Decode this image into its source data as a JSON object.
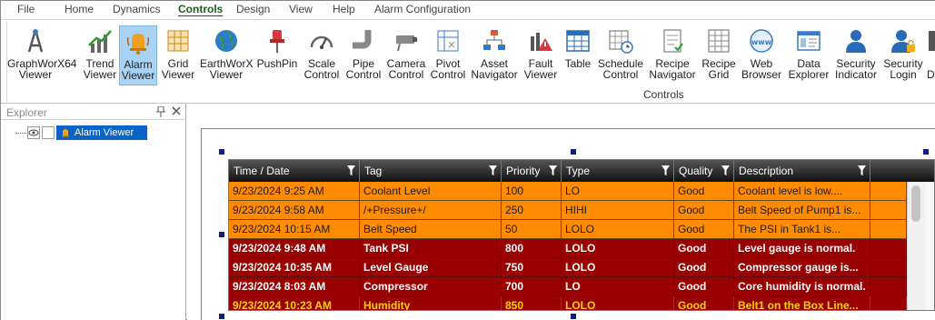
{
  "menu": {
    "items": [
      "File",
      "Home",
      "Dynamics",
      "Controls",
      "Design",
      "View",
      "Help",
      "Alarm Configuration"
    ],
    "active": "Controls"
  },
  "ribbon": {
    "group_label": "Controls",
    "buttons": [
      {
        "line1": "GraphWorX64",
        "line2": "Viewer",
        "icon": "graphworx-icon"
      },
      {
        "line1": "Trend",
        "line2": "Viewer",
        "icon": "trend-icon"
      },
      {
        "line1": "Alarm",
        "line2": "Viewer",
        "icon": "alarm-bell-icon"
      },
      {
        "line1": "Grid",
        "line2": "Viewer",
        "icon": "grid-icon"
      },
      {
        "line1": "EarthWorX",
        "line2": "Viewer",
        "icon": "globe-icon"
      },
      {
        "line1": "PushPin",
        "line2": "",
        "icon": "pushpin-icon"
      },
      {
        "line1": "Scale",
        "line2": "Control",
        "icon": "gauge-icon"
      },
      {
        "line1": "Pipe",
        "line2": "Control",
        "icon": "pipe-icon"
      },
      {
        "line1": "Camera",
        "line2": "Control",
        "icon": "camera-icon"
      },
      {
        "line1": "Pivot",
        "line2": "Control",
        "icon": "pivot-icon"
      },
      {
        "line1": "Asset",
        "line2": "Navigator",
        "icon": "asset-tree-icon"
      },
      {
        "line1": "Fault",
        "line2": "Viewer",
        "icon": "fault-icon"
      },
      {
        "line1": "Table",
        "line2": "",
        "icon": "table-icon"
      },
      {
        "line1": "Schedule",
        "line2": "Control",
        "icon": "schedule-icon"
      },
      {
        "line1": "Recipe",
        "line2": "Navigator",
        "icon": "recipe-nav-icon"
      },
      {
        "line1": "Recipe",
        "line2": "Grid",
        "icon": "recipe-grid-icon"
      },
      {
        "line1": "Web",
        "line2": "Browser",
        "icon": "www-icon"
      },
      {
        "line1": "Data",
        "line2": "Explorer",
        "icon": "data-explorer-icon"
      },
      {
        "line1": "Security",
        "line2": "Indicator",
        "icon": "security-user-icon"
      },
      {
        "line1": "Security",
        "line2": "Login",
        "icon": "security-login-icon"
      },
      {
        "line1": "",
        "line2": "Di",
        "icon": "partial-icon"
      }
    ]
  },
  "explorer": {
    "title": "Explorer",
    "tree_item": "Alarm Viewer"
  },
  "alarm_grid": {
    "columns": [
      "Time / Date",
      "Tag",
      "Priority",
      "Type",
      "Quality",
      "Description"
    ],
    "rows": [
      {
        "time": "9/23/2024 9:25 AM",
        "tag": "Coolant Level",
        "priority": "100",
        "type": "LO",
        "quality": "Good",
        "desc": "Coolant level is low....",
        "style": "orange"
      },
      {
        "time": "9/23/2024 9:58 AM",
        "tag": "/+Pressure+/",
        "priority": "250",
        "type": "HIHI",
        "quality": "Good",
        "desc": "Belt Speed of Pump1 is...",
        "style": "orange"
      },
      {
        "time": "9/23/2024 10:15 AM",
        "tag": "Belt Speed",
        "priority": "50",
        "type": "LOLO",
        "quality": "Good",
        "desc": "The PSI in Tank1 is...",
        "style": "orange"
      },
      {
        "time": "9/23/2024 9:48 AM",
        "tag": "Tank PSI",
        "priority": "800",
        "type": "LOLO",
        "quality": "Good",
        "desc": "Level gauge is normal.",
        "style": "red"
      },
      {
        "time": "9/23/2024 10:35 AM",
        "tag": "Level Gauge",
        "priority": "750",
        "type": "LOLO",
        "quality": "Good",
        "desc": "Compressor gauge is...",
        "style": "red"
      },
      {
        "time": "9/23/2024 8:03 AM",
        "tag": "Compressor",
        "priority": "700",
        "type": "LO",
        "quality": "Good",
        "desc": "Core humidity is normal.",
        "style": "red"
      },
      {
        "time": "9/23/2024 10:23 AM",
        "tag": "Humidity",
        "priority": "850",
        "type": "LOLO",
        "quality": "Good",
        "desc": "Belt1 on the Box Line...",
        "style": "red-yellow"
      }
    ]
  },
  "colors": {
    "accent_selected": "#a9d3f5",
    "row_orange": "#ff8c00",
    "row_red": "#990000",
    "row_yellow_text": "#ffd400",
    "tree_selected": "#0a64c8"
  }
}
